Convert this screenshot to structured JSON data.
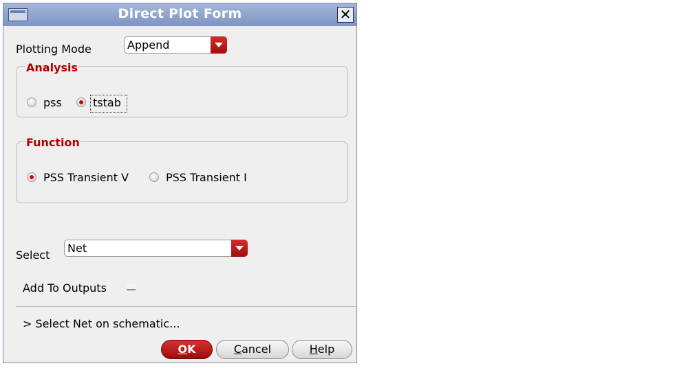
{
  "window": {
    "title": "Direct Plot Form",
    "close_glyph": "✕"
  },
  "plotting_mode": {
    "label": "Plotting Mode",
    "value": "Append"
  },
  "analysis": {
    "legend": "Analysis",
    "options": [
      {
        "label": "pss",
        "selected": false
      },
      {
        "label": "tstab",
        "selected": true
      }
    ]
  },
  "function": {
    "legend": "Function",
    "options": [
      {
        "label": "PSS Transient V",
        "selected": true
      },
      {
        "label": "PSS Transient I",
        "selected": false
      }
    ]
  },
  "select": {
    "label": "Select",
    "value": "Net"
  },
  "add_to_outputs": {
    "label": "Add To Outputs",
    "checked": false
  },
  "status": {
    "text": "> Select Net on schematic..."
  },
  "buttons": {
    "ok": {
      "mnemonic": "O",
      "rest": "K"
    },
    "cancel": {
      "mnemonic": "C",
      "rest": "ancel"
    },
    "help": {
      "mnemonic": "H",
      "rest": "elp"
    }
  },
  "colors": {
    "accent_red": "#b30000",
    "titlebar": "#8fa3cc"
  }
}
